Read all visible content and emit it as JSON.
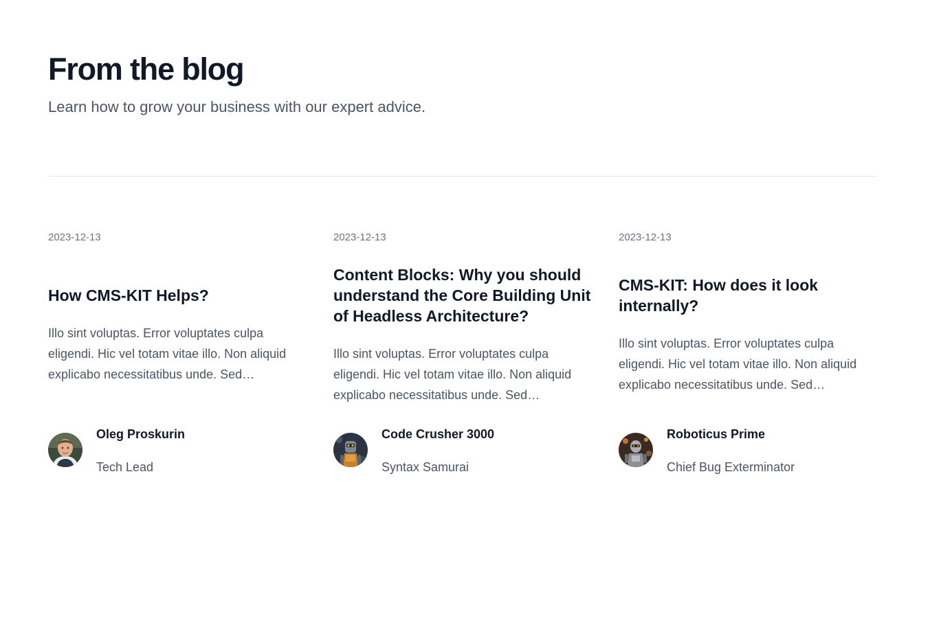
{
  "header": {
    "title": "From the blog",
    "subtitle": "Learn how to grow your business with our expert advice."
  },
  "posts": [
    {
      "date": "2023-12-13",
      "title": "How CMS-KIT Helps?",
      "excerpt": "Illo sint voluptas. Error voluptates culpa eligendi. Hic vel totam vitae illo. Non aliquid explicabo necessitatibus unde. Sed…",
      "author": {
        "name": "Oleg Proskurin",
        "role": "Tech Lead",
        "avatar_icon": "person-avatar"
      }
    },
    {
      "date": "2023-12-13",
      "title": "Content Blocks: Why you should understand the Core Building Unit of Headless Architecture?",
      "excerpt": "Illo sint voluptas. Error voluptates culpa eligendi. Hic vel totam vitae illo. Non aliquid explicabo necessitatibus unde. Sed…",
      "author": {
        "name": "Code Crusher 3000",
        "role": "Syntax Samurai",
        "avatar_icon": "robot-avatar"
      }
    },
    {
      "date": "2023-12-13",
      "title": "CMS-KIT: How does it look internally?",
      "excerpt": "Illo sint voluptas. Error voluptates culpa eligendi. Hic vel totam vitae illo. Non aliquid explicabo necessitatibus unde. Sed…",
      "author": {
        "name": "Roboticus Prime",
        "role": "Chief Bug Exterminator",
        "avatar_icon": "robot-avatar"
      }
    }
  ],
  "colors": {
    "heading": "#111827",
    "body_text": "#4b5563",
    "muted": "#6b7280",
    "divider": "#e5e7eb"
  }
}
